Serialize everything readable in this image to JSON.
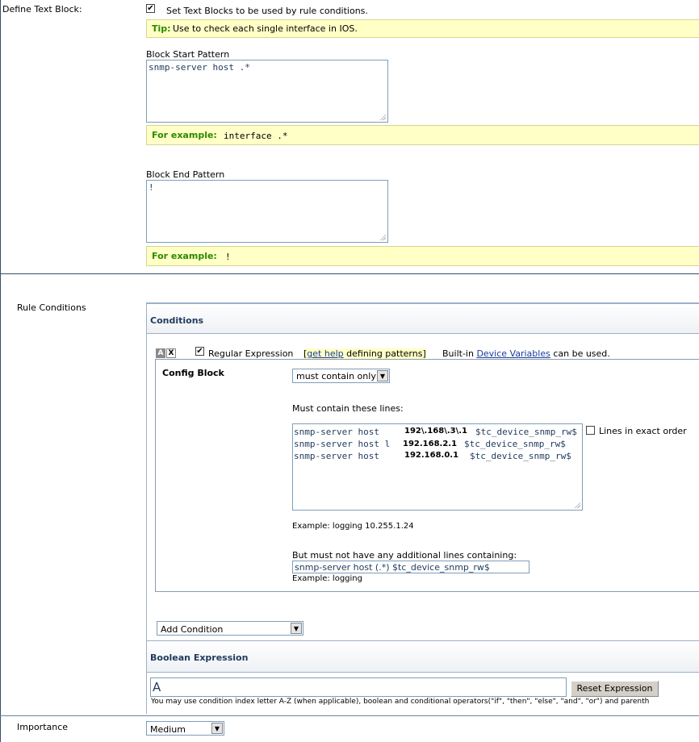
{
  "text_block": {
    "label": "Define Text Block:",
    "checkbox_label": "Set Text Blocks to be used by rule conditions.",
    "tip_prefix": "Tip:",
    "tip_text": " Use to check each single interface in IOS.",
    "start_label": "Block Start Pattern",
    "start_value": "snmp-server host .*",
    "start_example_prefix": "For example:",
    "start_example_value": "interface .*",
    "end_label": "Block End Pattern",
    "end_value": "!",
    "end_example_prefix": "For example:",
    "end_example_value": "!"
  },
  "rule_conditions": {
    "label": "Rule Conditions",
    "header": "Conditions",
    "index_letter": "A",
    "delete_glyph": "X",
    "regex_label": "Regular Expression",
    "help_bracket_open": "[",
    "help_link": "get help",
    "help_suffix": " defining patterns",
    "help_bracket_close": "]",
    "builtin_prefix": "Built-in ",
    "device_vars_link": "Device Variables",
    "builtin_suffix": " can be used.",
    "config_block_label": "Config Block",
    "mode_select": "must contain only",
    "must_contain_label": "Must contain these lines:",
    "lines": [
      {
        "prefix": "snmp-server host",
        "ip": "192\\.168\\.3\\.1",
        "suffix": "$tc_device_snmp_rw$"
      },
      {
        "prefix": "snmp-server host l",
        "ip": "192.168.2.1",
        "suffix": "$tc_device_snmp_rw$"
      },
      {
        "prefix": "snmp-server host",
        "ip": "192.168.0.1",
        "suffix": "$tc_device_snmp_rw$"
      }
    ],
    "exact_order_label": "Lines in exact order",
    "example1": "Example: logging 10.255.1.24",
    "must_not_label": "But must not have any additional lines containing:",
    "must_not_value": "snmp-server host (.*) $tc_device_snmp_rw$",
    "example2": "Example: logging",
    "add_condition": "Add Condition"
  },
  "boolean": {
    "header": "Boolean Expression",
    "value": "A",
    "reset_button": "Reset Expression",
    "hint": "You may use condition index letter A-Z (when applicable), boolean and conditional operators(\"if\", \"then\", \"else\", \"and\", \"or\") and parenth"
  },
  "importance": {
    "label": "Importance",
    "value": "Medium"
  },
  "icons": {
    "check": "checkmark-icon",
    "dropdown": "chevron-down-icon",
    "resize": "resize-grip-icon"
  }
}
